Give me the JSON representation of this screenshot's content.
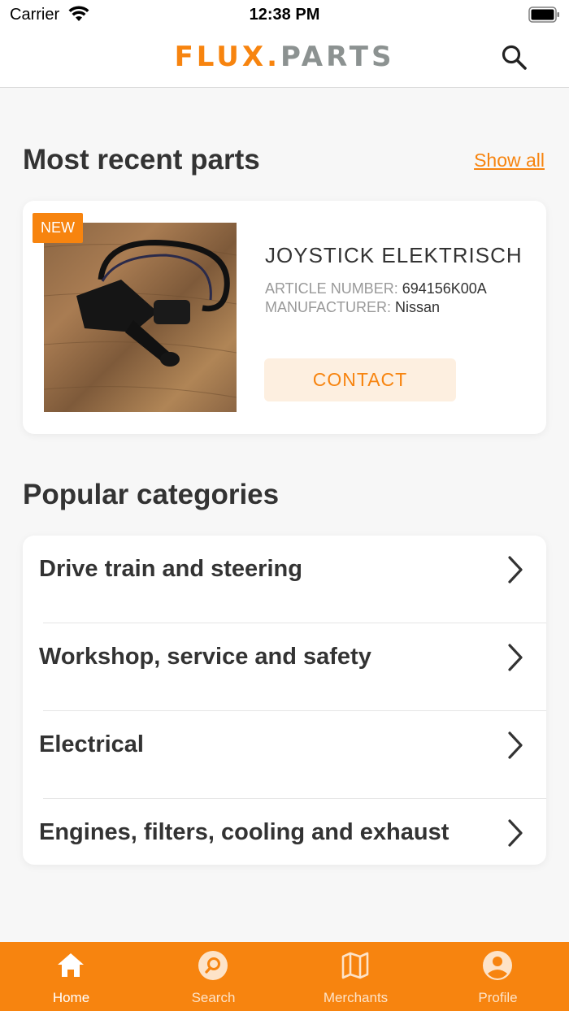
{
  "status_bar": {
    "carrier": "Carrier",
    "time": "12:38 PM"
  },
  "header": {
    "logo_primary": "FLUX.",
    "logo_secondary": "PARTS",
    "search_icon": "search-icon"
  },
  "recent": {
    "title": "Most recent parts",
    "show_all": "Show all",
    "product": {
      "badge": "NEW",
      "name": "JOYSTICK ELEKTRISCH",
      "article_label": "ARTICLE NUMBER: ",
      "article_value": "694156K00A",
      "manufacturer_label": "MANUFACTURER: ",
      "manufacturer_value": "Nissan",
      "contact_label": "CONTACT"
    }
  },
  "categories": {
    "title": "Popular categories",
    "items": [
      {
        "label": "Drive train and steering"
      },
      {
        "label": "Workshop, service and safety"
      },
      {
        "label": "Electrical"
      },
      {
        "label": "Engines, filters, cooling and exhaust"
      }
    ]
  },
  "tabs": [
    {
      "label": "Home",
      "icon": "home-icon",
      "active": true
    },
    {
      "label": "Search",
      "icon": "search-circle-icon",
      "active": false
    },
    {
      "label": "Merchants",
      "icon": "map-icon",
      "active": false
    },
    {
      "label": "Profile",
      "icon": "user-circle-icon",
      "active": false
    }
  ],
  "colors": {
    "accent": "#f7840f",
    "accent_light": "#fdefe0",
    "logo_gray": "#8c9291",
    "text": "#333333",
    "muted": "#999999",
    "background": "#f7f7f7"
  }
}
